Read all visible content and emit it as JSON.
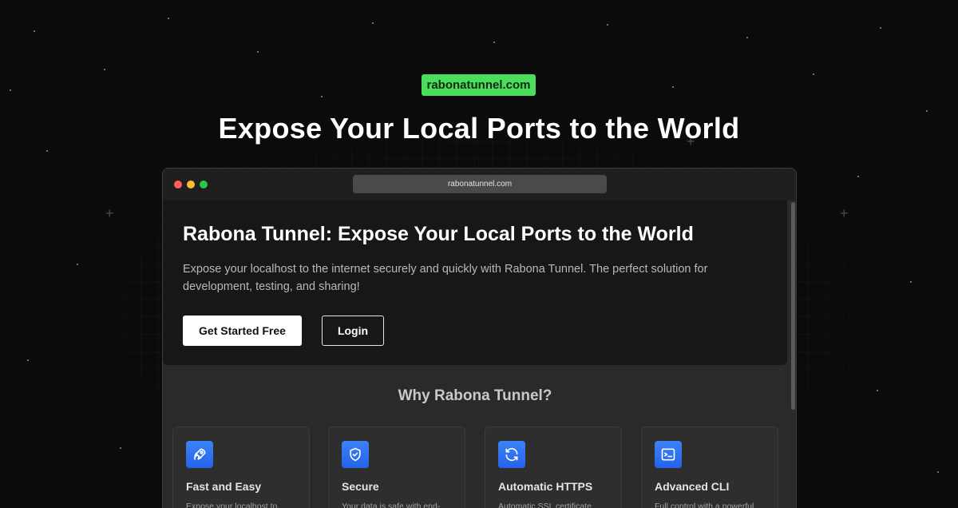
{
  "top_badge": {
    "label": "rabonatunnel.com"
  },
  "hero": {
    "title": "Expose Your Local Ports to the World"
  },
  "browser": {
    "url": "rabonatunnel.com",
    "traffic_lights": {
      "close_color": "#ff5f57",
      "minimize_color": "#febc2e",
      "maximize_color": "#28c840"
    }
  },
  "page": {
    "hero_card": {
      "heading": "Rabona Tunnel: Expose Your Local Ports to the World",
      "description": "Expose your localhost to the internet securely and quickly with Rabona Tunnel. The perfect solution for development, testing, and sharing!",
      "primary_button": "Get Started Free",
      "secondary_button": "Login"
    },
    "features_section": {
      "title": "Why Rabona Tunnel?",
      "items": [
        {
          "icon": "rocket-icon",
          "title": "Fast and Easy",
          "desc": "Expose your localhost to"
        },
        {
          "icon": "shield-check-icon",
          "title": "Secure",
          "desc": "Your data is safe with end-"
        },
        {
          "icon": "refresh-icon",
          "title": "Automatic HTTPS",
          "desc": "Automatic SSL certificate"
        },
        {
          "icon": "terminal-icon",
          "title": "Advanced CLI",
          "desc": "Full control with a powerful"
        }
      ]
    }
  },
  "colors": {
    "accent_green": "#4ade5a",
    "icon_blue": "#3b82f6",
    "background": "#0b0b0b"
  }
}
